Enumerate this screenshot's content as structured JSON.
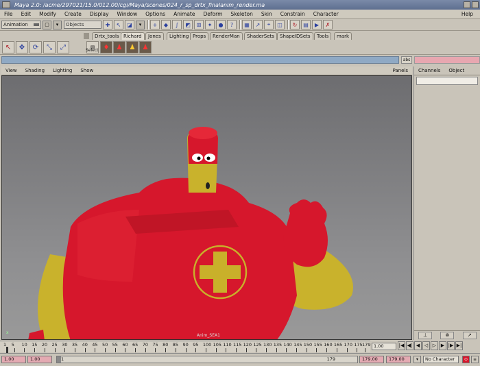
{
  "window": {
    "title": "Maya 2.0: /acme/297021/15.0/012.00/cgi/Maya/scenes/024_r_sp_drtx_finalanim_render.ma"
  },
  "menubar": {
    "items": [
      "File",
      "Edit",
      "Modify",
      "Create",
      "Display",
      "Window",
      "Options",
      "Animate",
      "Deform",
      "Skeleton",
      "Skin",
      "Constrain",
      "Character"
    ],
    "help": "Help"
  },
  "statusline": {
    "mode": "Animation",
    "objects_placeholder": "Objects"
  },
  "shelf": {
    "tabs": [
      "Drtx_tools",
      "Richard",
      "Jones",
      "Lighting",
      "Props",
      "RenderMan",
      "ShaderSets",
      "ShapeIDSets",
      "Tools",
      "mark"
    ],
    "active_tab": "Richard",
    "select_label": "Select"
  },
  "cmdline": {
    "abs_label": "abs"
  },
  "viewport": {
    "menu": [
      "View",
      "Shading",
      "Lighting",
      "Show"
    ],
    "panels": "Panels",
    "camera_label": "Anim_SEA1",
    "axis_label": "x"
  },
  "channelbox": {
    "headers": [
      "Channels",
      "Object"
    ]
  },
  "timeslider": {
    "ticks": [
      "1",
      "5",
      "10",
      "15",
      "20",
      "25",
      "30",
      "35",
      "40",
      "45",
      "50",
      "55",
      "60",
      "65",
      "70",
      "75",
      "80",
      "85",
      "90",
      "95",
      "100",
      "105",
      "110",
      "115",
      "120",
      "125",
      "130",
      "135",
      "140",
      "145",
      "150",
      "155",
      "160",
      "165",
      "170",
      "175",
      "179"
    ],
    "current_frame": "1.00"
  },
  "rangeslider": {
    "start_time": "1.00",
    "playback_start": "1.00",
    "range_start": "1",
    "range_end": "179",
    "playback_end": "179.00",
    "end_time": "179.00",
    "character": "No Character"
  },
  "colors": {
    "body_red": "#d6172c",
    "limb_yellow": "#c9b22c",
    "cross_yellow": "#c9b02a",
    "cmd_field": "#8fa9c4",
    "pink_field": "#e4aab2"
  }
}
